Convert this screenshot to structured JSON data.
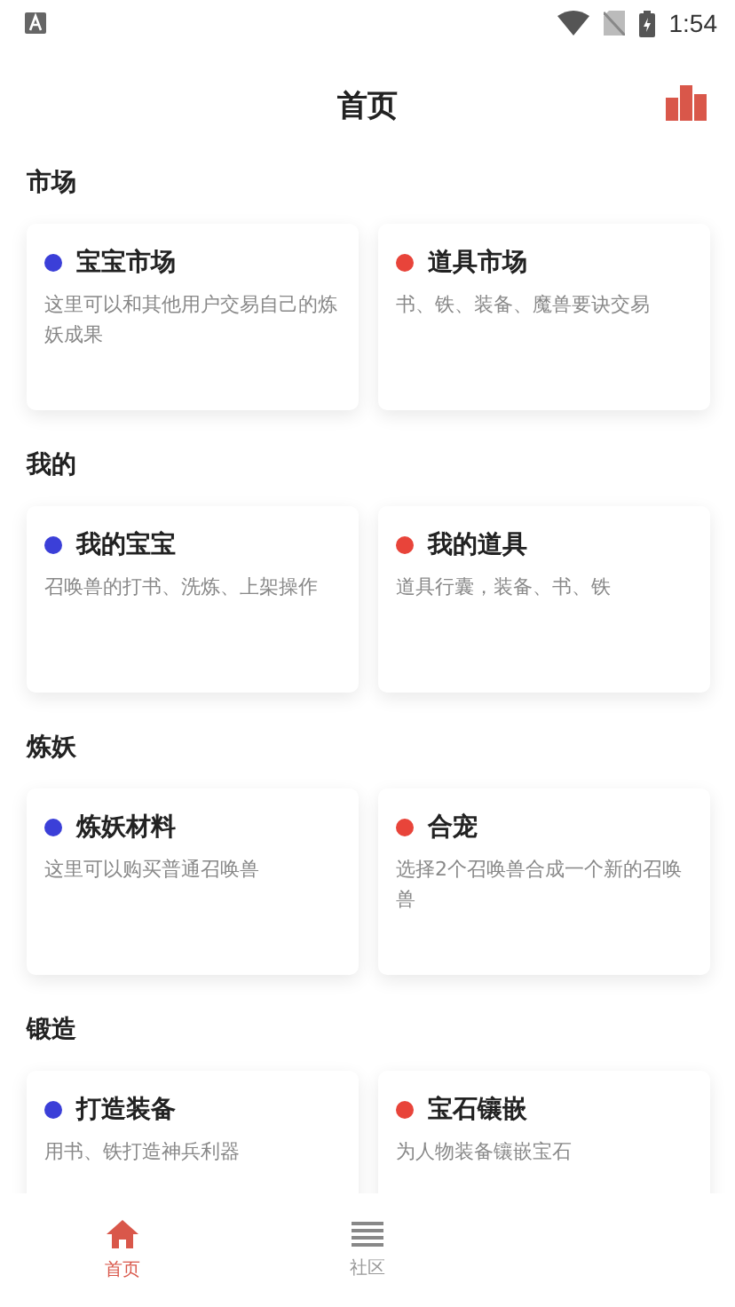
{
  "status_bar": {
    "time": "1:54"
  },
  "header": {
    "title": "首页"
  },
  "sections": [
    {
      "title": "市场",
      "cards": [
        {
          "title": "宝宝市场",
          "description": "这里可以和其他用户交易自己的炼妖成果",
          "color": "#3b3fd8"
        },
        {
          "title": "道具市场",
          "description": "书、铁、装备、魔兽要诀交易",
          "color": "#e8443a"
        }
      ]
    },
    {
      "title": "我的",
      "cards": [
        {
          "title": "我的宝宝",
          "description": "召唤兽的打书、洗炼、上架操作",
          "color": "#3b3fd8"
        },
        {
          "title": "我的道具",
          "description": "道具行囊，装备、书、铁",
          "color": "#e8443a"
        }
      ]
    },
    {
      "title": "炼妖",
      "cards": [
        {
          "title": "炼妖材料",
          "description": "这里可以购买普通召唤兽",
          "color": "#3b3fd8"
        },
        {
          "title": "合宠",
          "description": "选择2个召唤兽合成一个新的召唤兽",
          "color": "#e8443a"
        }
      ]
    },
    {
      "title": "锻造",
      "cards": [
        {
          "title": "打造装备",
          "description": "用书、铁打造神兵利器",
          "color": "#3b3fd8"
        },
        {
          "title": "宝石镶嵌",
          "description": "为人物装备镶嵌宝石",
          "color": "#e8443a"
        }
      ]
    }
  ],
  "tab_bar": [
    {
      "label": "首页",
      "selected": true,
      "kind": "home"
    },
    {
      "label": "社区",
      "selected": false,
      "kind": "list"
    }
  ]
}
